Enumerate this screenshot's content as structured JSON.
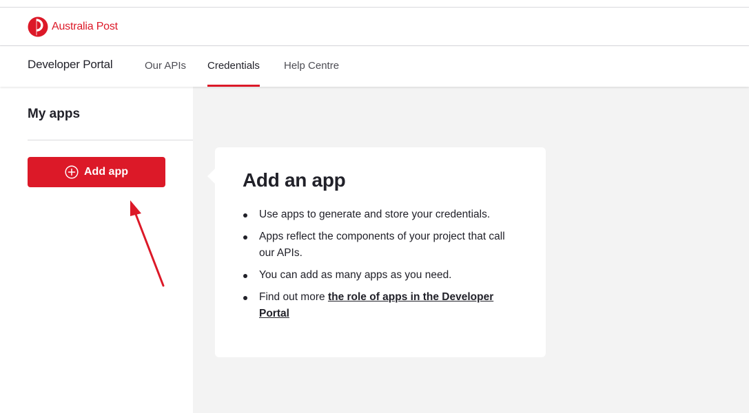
{
  "brand": {
    "name": "Australia Post",
    "color": "#dc1928",
    "logo_icon": "australia-post-logo-icon"
  },
  "nav": {
    "portal_title": "Developer Portal",
    "links": [
      {
        "label": "Our APIs",
        "active": false
      },
      {
        "label": "Credentials",
        "active": true
      },
      {
        "label": "Help Centre",
        "active": false
      }
    ]
  },
  "sidebar": {
    "title": "My apps",
    "add_button": {
      "label": "Add app",
      "icon": "plus-circle-icon"
    }
  },
  "card": {
    "title": "Add an app",
    "items": [
      "Use apps to generate and store your credentials.",
      "Apps reflect the components of your project that call our APIs.",
      "You can add as many apps as you need."
    ],
    "last_item_prefix": "Find out more ",
    "last_item_link": "the role of apps in the Developer Portal"
  },
  "annotation": {
    "type": "arrow",
    "color": "#dc1928",
    "points_to": "add-app-button"
  }
}
